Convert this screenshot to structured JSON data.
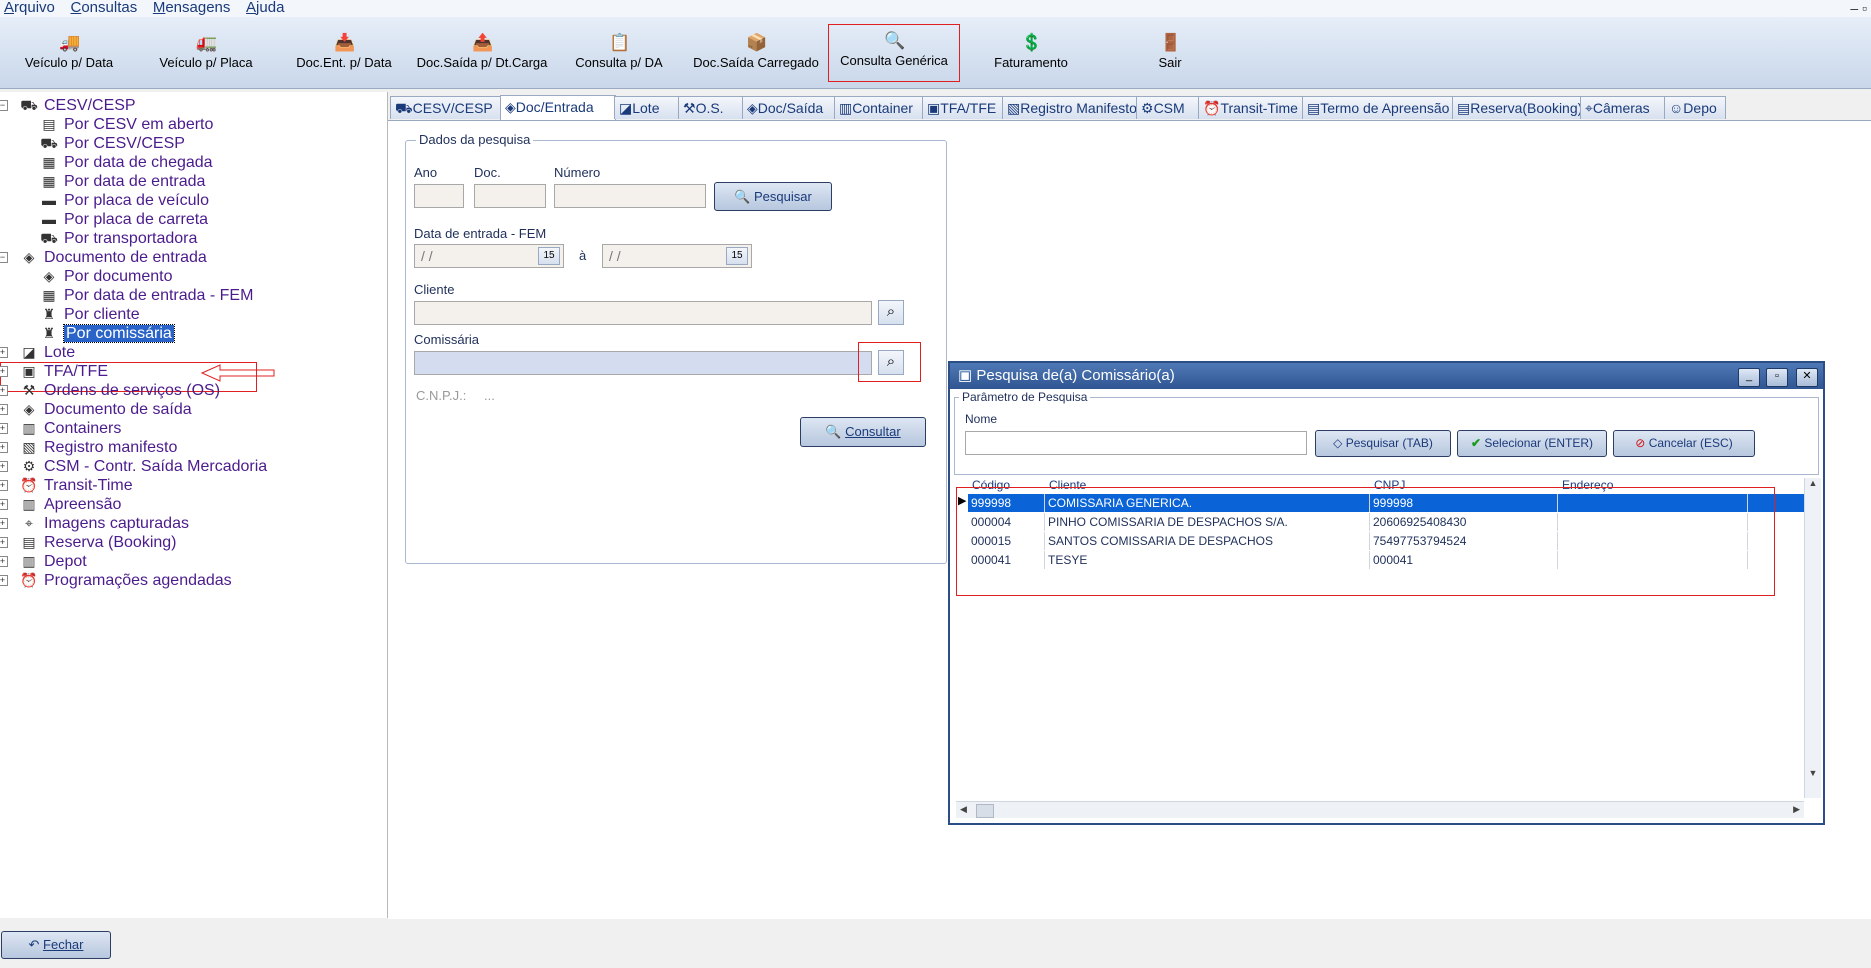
{
  "menu": [
    "Arquivo",
    "Consultas",
    "Mensagens",
    "Ajuda"
  ],
  "window_controls": "– ▫",
  "toolbar": [
    {
      "label": "Veículo p/ Data",
      "icon": "truck-icon"
    },
    {
      "label": "Veículo p/ Placa",
      "icon": "truck-plate-icon"
    },
    {
      "label": "Doc.Ent. p/ Data",
      "icon": "doc-in-icon"
    },
    {
      "label": "Doc.Saída p/ Dt.Carga",
      "icon": "doc-out-icon"
    },
    {
      "label": "Consulta p/ DA",
      "icon": "query-da-icon"
    },
    {
      "label": "Doc.Saída Carregado",
      "icon": "loaded-doc-icon"
    },
    {
      "label": "Consulta Genérica",
      "icon": "generic-query-icon"
    },
    {
      "label": "Faturamento",
      "icon": "billing-icon"
    },
    {
      "label": "Sair",
      "icon": "exit-icon"
    }
  ],
  "tree": {
    "cesv": "CESV/CESP",
    "cesv_children": [
      "Por CESV em aberto",
      "Por CESV/CESP",
      "Por data de chegada",
      "Por data de entrada",
      "Por placa de veículo",
      "Por placa de carreta",
      "Por transportadora"
    ],
    "docentrada": "Documento de entrada",
    "docentrada_children": [
      "Por documento",
      "Por data de entrada - FEM",
      "Por cliente",
      "Por comissária"
    ],
    "others": [
      "Lote",
      "TFA/TFE",
      "Ordens de serviços (OS)",
      "Documento de saída",
      "Containers",
      "Registro manifesto",
      "CSM - Contr. Saída Mercadoria",
      "Transit-Time",
      "Apreensão",
      "Imagens capturadas",
      "Reserva (Booking)",
      "Depot",
      "Programações agendadas"
    ]
  },
  "tabs": [
    "CESV/CESP",
    "Doc/Entrada",
    "Lote",
    "O.S.",
    "Doc/Saída",
    "Container",
    "TFA/TFE",
    "Registro Manifesto",
    "CSM",
    "Transit-Time",
    "Termo de Apreensão",
    "Reserva(Booking)",
    "Câmeras",
    "Depo"
  ],
  "form": {
    "group_title": "Dados da pesquisa",
    "ano_label": "Ano",
    "doc_label": "Doc.",
    "numero_label": "Número",
    "pesquisar": "Pesquisar",
    "data_label": "Data de entrada - FEM",
    "date_placeholder": "/ /",
    "date_sep": "à",
    "cal_glyph": "15",
    "cliente_label": "Cliente",
    "comissaria_label": "Comissária",
    "cnpj_label": "C.N.P.J.:",
    "cnpj_value": "...",
    "consultar": "Consultar"
  },
  "dialog": {
    "title": "Pesquisa de(a) Comissário(a)",
    "param_title": "Parâmetro de Pesquisa",
    "nome_label": "Nome",
    "btn_pesquisar": "Pesquisar (TAB)",
    "btn_selecionar": "Selecionar (ENTER)",
    "btn_cancelar": "Cancelar (ESC)",
    "columns": [
      "Código",
      "Cliente",
      "CNPJ",
      "Endereço"
    ],
    "rows": [
      [
        "999998",
        "COMISSARIA GENERICA.",
        "999998",
        ""
      ],
      [
        "000004",
        "PINHO COMISSARIA DE DESPACHOS S/A.",
        "20606925408430",
        ""
      ],
      [
        "000015",
        "SANTOS COMISSARIA DE DESPACHOS",
        "75497753794524",
        ""
      ],
      [
        "000041",
        "TESYE",
        "000041",
        ""
      ]
    ]
  },
  "fechar": "Fechar",
  "colors": {
    "accent": "#2f5592",
    "selection": "#0a64d8",
    "highlight": "#e02020",
    "tree_text": "#4b1c8c"
  }
}
